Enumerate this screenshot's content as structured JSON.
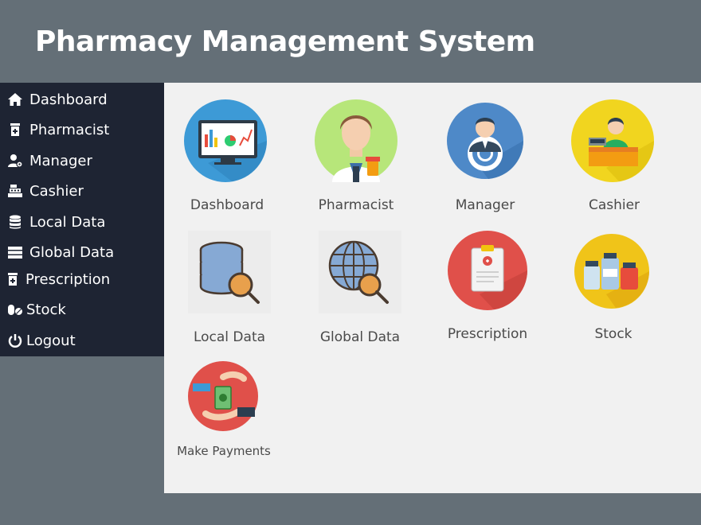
{
  "app": {
    "title": "Pharmacy Management System"
  },
  "sidebar": {
    "items": [
      {
        "label": "Dashboard",
        "icon": "home-icon"
      },
      {
        "label": "Pharmacist",
        "icon": "medicine-bottle-icon"
      },
      {
        "label": "Manager",
        "icon": "user-cog-icon"
      },
      {
        "label": "Cashier",
        "icon": "cash-register-icon"
      },
      {
        "label": "Local Data",
        "icon": "database-icon"
      },
      {
        "label": "Global Data",
        "icon": "server-icon"
      },
      {
        "label": "Prescription",
        "icon": "prescription-bottle-icon"
      },
      {
        "label": "Stock",
        "icon": "pills-icon"
      },
      {
        "label": "Logout",
        "icon": "power-icon"
      }
    ]
  },
  "tiles": [
    {
      "label": "Dashboard",
      "icon": "dashboard-monitor-icon"
    },
    {
      "label": "Pharmacist",
      "icon": "pharmacist-avatar-icon"
    },
    {
      "label": "Manager",
      "icon": "manager-gear-icon"
    },
    {
      "label": "Cashier",
      "icon": "cashier-register-icon"
    },
    {
      "label": "Local Data",
      "icon": "local-database-search-icon"
    },
    {
      "label": "Global Data",
      "icon": "globe-database-search-icon"
    },
    {
      "label": "Prescription",
      "icon": "clipboard-prescription-icon"
    },
    {
      "label": "Stock",
      "icon": "medicine-bottles-icon"
    },
    {
      "label": "Make Payments",
      "icon": "money-handover-icon"
    }
  ],
  "colors": {
    "header_bg": "#646f77",
    "sidebar_bg": "#1e2433",
    "content_bg": "#f1f1f1",
    "text_white": "#ffffff",
    "label_text": "#4a4a4a"
  }
}
